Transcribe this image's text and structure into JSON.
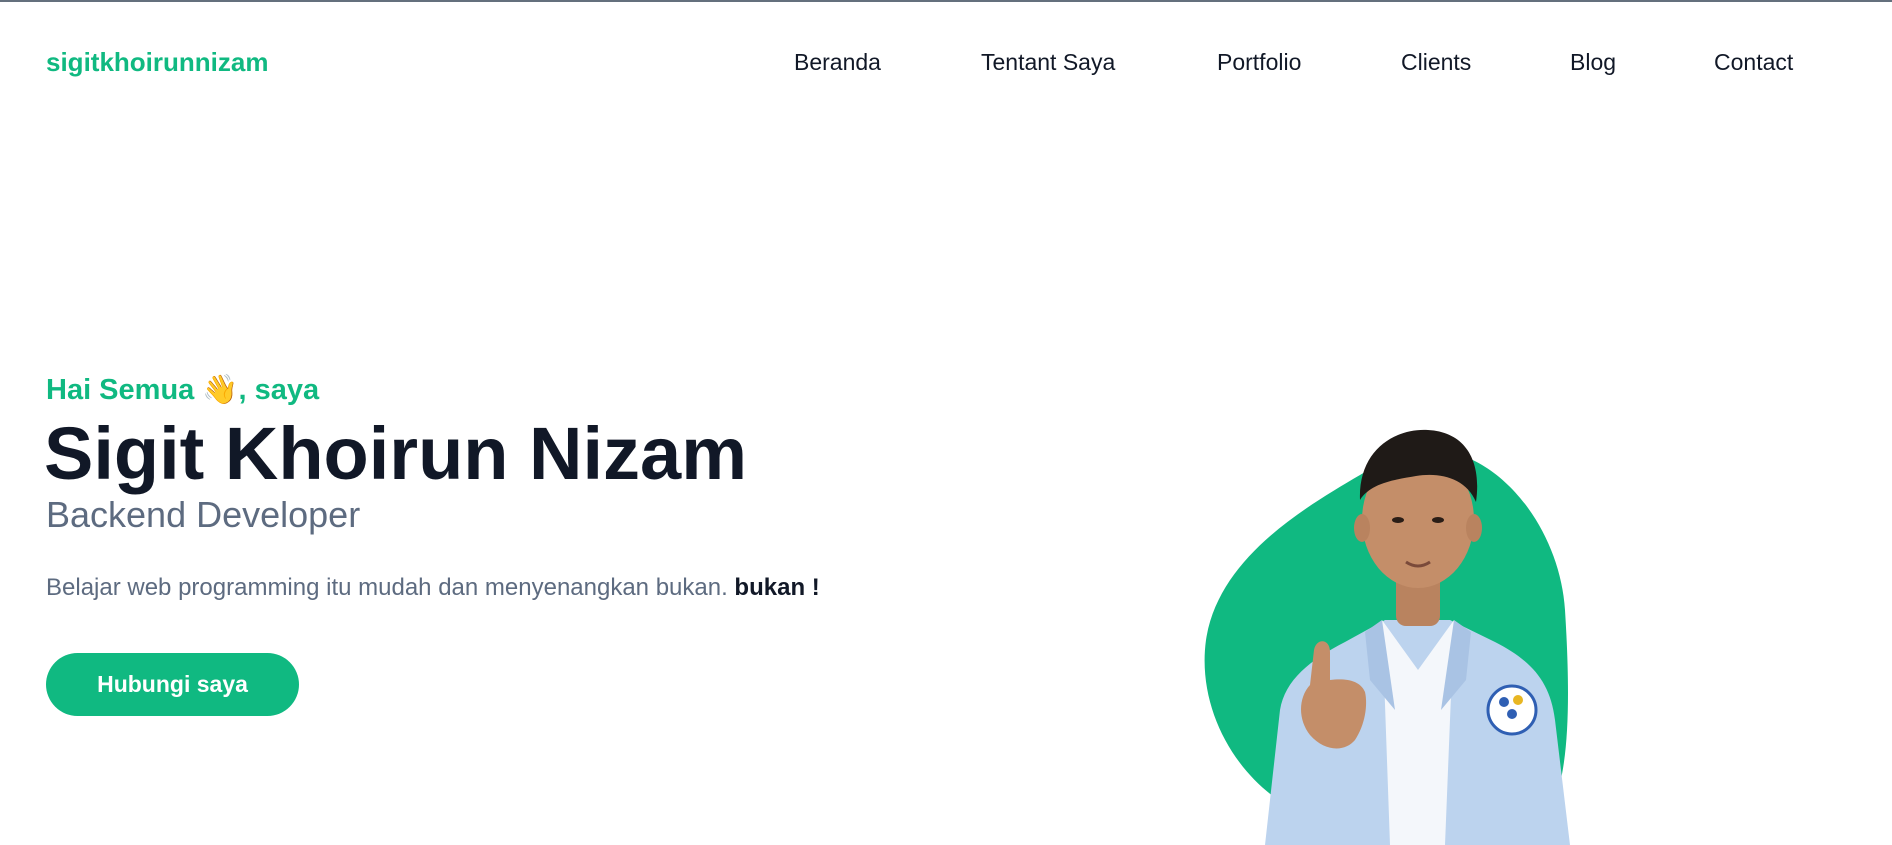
{
  "brand": {
    "name": "sigitkhoirunnizam",
    "accent_color": "#10b981"
  },
  "nav": {
    "items": [
      {
        "label": "Beranda"
      },
      {
        "label": "Tentant Saya"
      },
      {
        "label": "Portfolio"
      },
      {
        "label": "Clients"
      },
      {
        "label": "Blog"
      },
      {
        "label": "Contact"
      }
    ]
  },
  "hero": {
    "greeting_text": "Hai Semua",
    "greeting_emoji": "👋",
    "greeting_suffix": ", saya",
    "name": "Sigit Khoirun Nizam",
    "role": "Backend Developer",
    "tagline": "Belajar web programming itu mudah dan menyenangkan bukan.",
    "tagline_emphasis": "bukan !",
    "cta_label": "Hubungi saya",
    "blob_color": "#10b981",
    "jacket_color": "#bcd3ee"
  }
}
